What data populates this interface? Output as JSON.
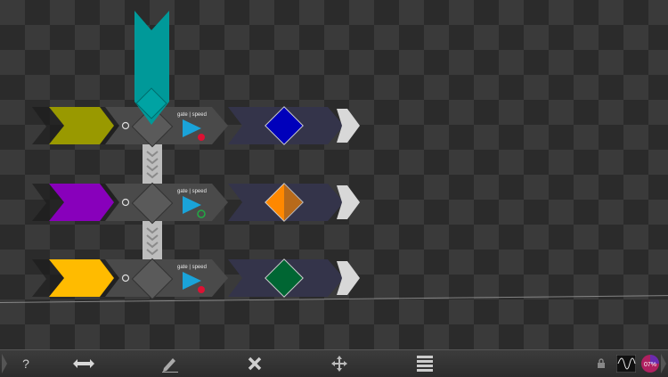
{
  "top_source": {
    "color": "#009999"
  },
  "rows": [
    {
      "input_color": "#999900",
      "param_label": "gate | speed",
      "indicator_color": "#dd1133",
      "indicator_filled": true,
      "gem_color": "#0000bb",
      "gem_style": "full"
    },
    {
      "input_color": "#8800bb",
      "param_label": "gate | speed",
      "indicator_color": "#22aa44",
      "indicator_filled": false,
      "gem_color": "#ff8800",
      "gem_style": "split"
    },
    {
      "input_color": "#ffbb00",
      "param_label": "gate | speed",
      "indicator_color": "#dd1133",
      "indicator_filled": true,
      "gem_color": "#006633",
      "gem_style": "full"
    }
  ],
  "toolbar": {
    "help_label": "?",
    "cpu_text": "07%",
    "icons": [
      "help-icon",
      "resize-icon",
      "pencil-icon",
      "delete-icon",
      "move-icon",
      "menu-icon",
      "lock-icon",
      "waveform-icon",
      "cpu-meter-icon"
    ]
  },
  "colors": {
    "play": "#1aa3d9",
    "body": "#4a4a4a",
    "gem_body": "#34344a"
  }
}
